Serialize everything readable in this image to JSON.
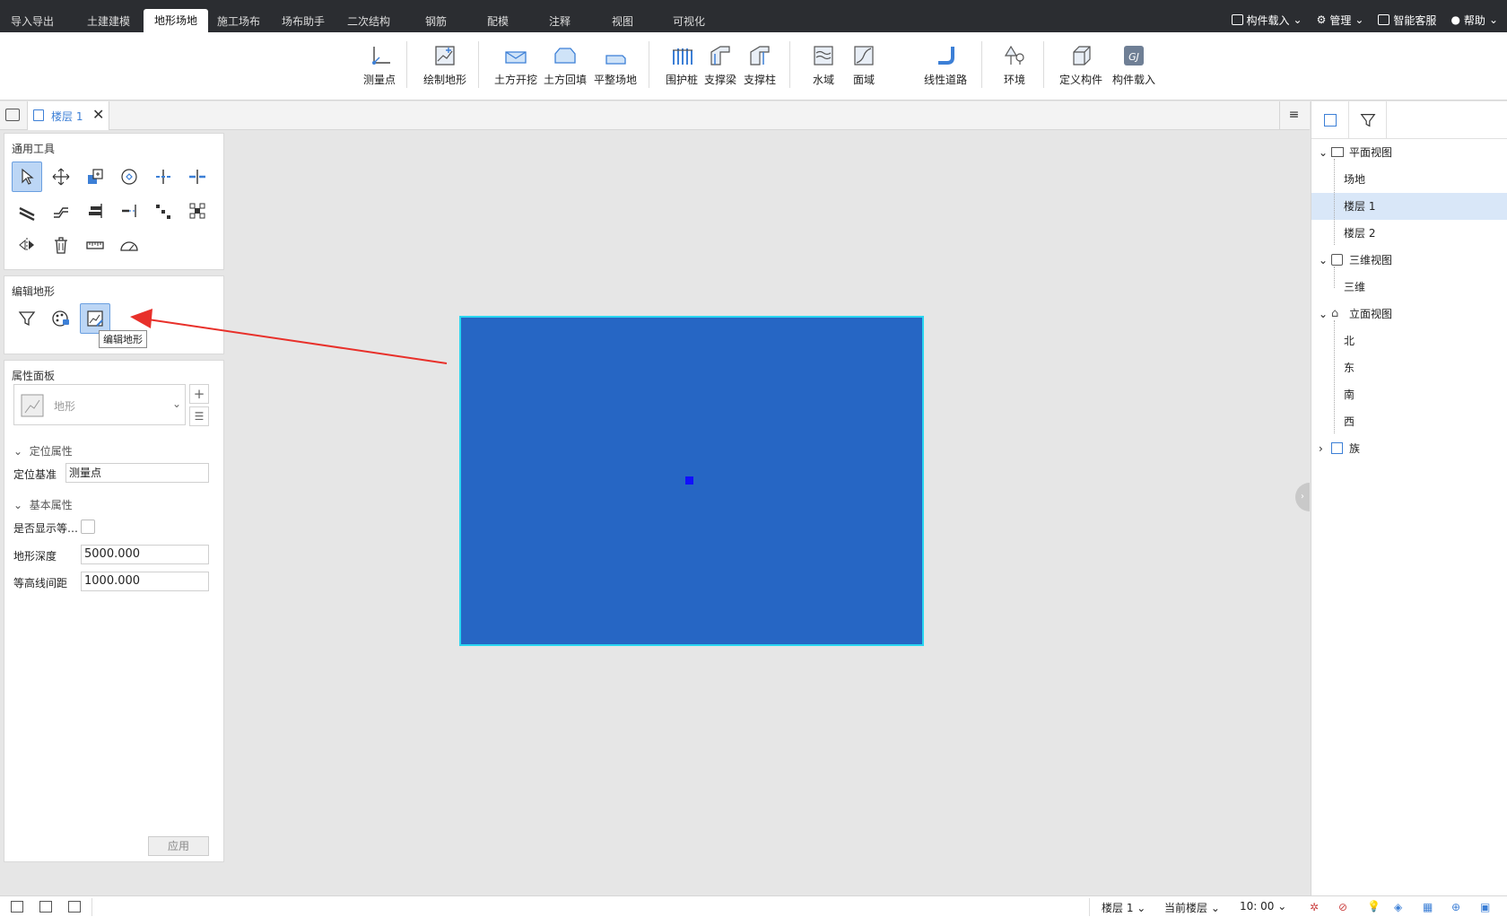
{
  "top_tabs": [
    "导入导出",
    "土建建模",
    "地形场地",
    "施工场布",
    "场布助手",
    "二次结构",
    "钢筋",
    "配模",
    "注释",
    "视图",
    "可视化"
  ],
  "top_right": {
    "load": "构件载入",
    "manage": "管理",
    "service": "智能客服",
    "help": "帮助"
  },
  "ribbon": {
    "survey_point": "测量点",
    "draw_terrain": "绘制地形",
    "excavation": "土方开挖",
    "backfill": "土方回填",
    "level_site": "平整场地",
    "guard_pile": "围护桩",
    "support_beam": "支撑梁",
    "support_column": "支撑柱",
    "water": "水域",
    "surface": "面域",
    "linear_road": "线性道路",
    "environment": "环境",
    "define_component": "定义构件",
    "component_load": "构件载入"
  },
  "doc_tab": {
    "label": "楼层 1"
  },
  "left": {
    "general_tools_title": "通用工具",
    "edit_terrain_title": "编辑地形",
    "tooltip": "编辑地形",
    "props_title": "属性面板",
    "type_value": "地形",
    "group_position": "定位属性",
    "position_base_label": "定位基准",
    "position_base_value": "测量点",
    "group_basic": "基本属性",
    "show_contour_label": "是否显示等…",
    "depth_label": "地形深度",
    "depth_value": "5000.000",
    "contour_interval_label": "等高线间距",
    "contour_interval_value": "1000.000",
    "apply": "应用"
  },
  "tree": {
    "plan_view": "平面视图",
    "site": "场地",
    "floor1": "楼层 1",
    "floor2": "楼层 2",
    "view3d": "三维视图",
    "three_d": "三维",
    "elevation": "立面视图",
    "north": "北",
    "east": "东",
    "south": "南",
    "west": "西",
    "family": "族"
  },
  "status": {
    "floor": "楼层 1",
    "current": "当前楼层",
    "scale": "10: 00"
  },
  "colors": {
    "terrain": "#2666c4",
    "terrain_border": "#2ad6f0",
    "arrow": "#e8302a",
    "accent": "#3c7fd6"
  }
}
